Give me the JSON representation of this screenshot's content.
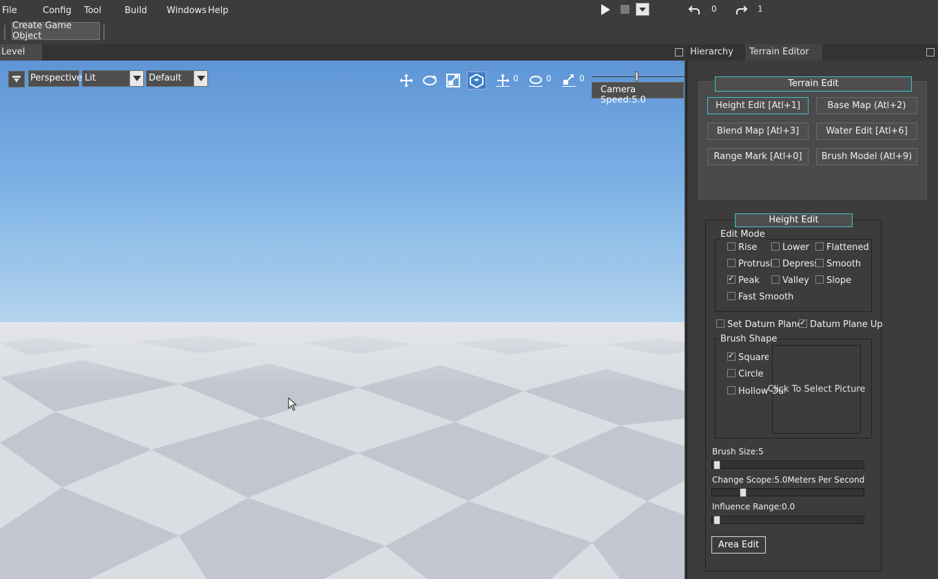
{
  "menu": [
    "File",
    "Config",
    "Tool",
    "Build",
    "Windows",
    "Help"
  ],
  "history": {
    "undo_count": "0",
    "redo_count": "1"
  },
  "toolbar": {
    "create_label": "Create Game Object"
  },
  "level_panel": {
    "tab": "Level"
  },
  "right_tabs": [
    "Hierarchy",
    "Terrain Editor"
  ],
  "viewport": {
    "projection": "Perspective",
    "shading": "Lit",
    "layout": "Default",
    "move_snap": "0",
    "rotate_snap": "0",
    "scale_snap": "0",
    "camera_speed": "Camera Speed:5.0",
    "sky_colors": [
      "#5e95d6",
      "#b4d4ef"
    ],
    "ground_color": "#dadde2"
  },
  "terrain_edit": {
    "title": "Terrain Edit",
    "modes": [
      "Height Edit [Atl+1]",
      "Base Map (Atl+2)",
      "Blend Map [Atl+3]",
      "Water Edit [Atl+6]",
      "Range Mark [Atl+0]",
      "Brush Model (Atl+9)"
    ],
    "active_mode": "Height Edit [Atl+1]"
  },
  "height_edit": {
    "title": "Height Edit",
    "edit_mode_label": "Edit Mode",
    "edit_modes": [
      {
        "label": "Rise",
        "checked": false
      },
      {
        "label": "Lower",
        "checked": false
      },
      {
        "label": "Flattened",
        "checked": false
      },
      {
        "label": "Protrusion",
        "checked": false
      },
      {
        "label": "Depression",
        "checked": false
      },
      {
        "label": "Smooth",
        "checked": false
      },
      {
        "label": "Peak",
        "checked": true
      },
      {
        "label": "Valley",
        "checked": false
      },
      {
        "label": "Slope",
        "checked": false
      },
      {
        "label": "Fast Smooth",
        "checked": false
      }
    ],
    "set_datum_plane": {
      "label": "Set Datum Plane",
      "checked": false
    },
    "datum_plane_up": {
      "label": "Datum Plane Up",
      "checked": true
    },
    "brush_shape_label": "Brush Shape",
    "brush_shapes": [
      {
        "label": "Square",
        "checked": true
      },
      {
        "label": "Circle",
        "checked": false
      },
      {
        "label": "Hollow Out",
        "checked": false
      }
    ],
    "picture_label": "Click To Select Picture",
    "brush_size": {
      "label": "Brush Size:5",
      "value": 0.0
    },
    "change_scope": {
      "label": "Change Scope:5.0Meters Per Second",
      "value": 0.18
    },
    "influence_range": {
      "label": "Influence Range:0.0",
      "value": 0.0
    },
    "area_edit_label": "Area Edit"
  },
  "accent_color": "#3ec4d2"
}
